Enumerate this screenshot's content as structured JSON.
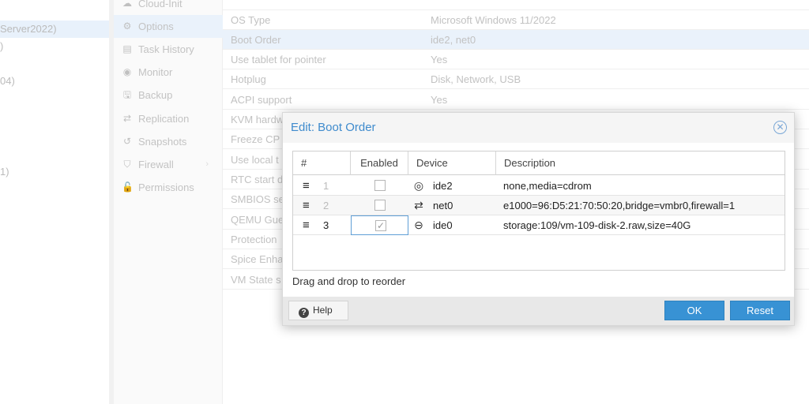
{
  "tree": {
    "items": [
      {
        "label": "Server2022)",
        "selected": true
      },
      {
        "label": ")",
        "selected": false
      },
      {
        "label": "04)",
        "selected": false
      },
      {
        "label": "1)",
        "selected": false
      }
    ]
  },
  "nav": {
    "items": [
      {
        "label": "Cloud-Init",
        "icon": "cloud-icon"
      },
      {
        "label": "Options",
        "icon": "gear-icon",
        "selected": true
      },
      {
        "label": "Task History",
        "icon": "list-icon"
      },
      {
        "label": "Monitor",
        "icon": "eye-icon"
      },
      {
        "label": "Backup",
        "icon": "floppy-icon"
      },
      {
        "label": "Replication",
        "icon": "retweet-icon"
      },
      {
        "label": "Snapshots",
        "icon": "history-icon"
      },
      {
        "label": "Firewall",
        "icon": "shield-icon",
        "has_submenu": true
      },
      {
        "label": "Permissions",
        "icon": "unlock-icon"
      }
    ]
  },
  "options": {
    "rows": [
      {
        "key": "OS Type",
        "value": "Microsoft Windows 11/2022"
      },
      {
        "key": "Boot Order",
        "value": "ide2, net0",
        "selected": true
      },
      {
        "key": "Use tablet for pointer",
        "value": "Yes"
      },
      {
        "key": "Hotplug",
        "value": "Disk, Network, USB"
      },
      {
        "key": "ACPI support",
        "value": "Yes"
      },
      {
        "key": "KVM hardw",
        "value": ""
      },
      {
        "key": "Freeze CP",
        "value": ""
      },
      {
        "key": "Use local t",
        "value": ""
      },
      {
        "key": "RTC start d",
        "value": ""
      },
      {
        "key": "SMBIOS se",
        "value": ""
      },
      {
        "key": "QEMU Gue",
        "value": ""
      },
      {
        "key": "Protection",
        "value": ""
      },
      {
        "key": "Spice Enha",
        "value": ""
      },
      {
        "key": "VM State s",
        "value": ""
      }
    ]
  },
  "dialog": {
    "title": "Edit: Boot Order",
    "close_icon": "close-circle-icon",
    "columns": {
      "num": "#",
      "enabled": "Enabled",
      "device": "Device",
      "description": "Description"
    },
    "rows": [
      {
        "num": "1",
        "enabled": false,
        "device_icon": "cdrom-icon",
        "device": "ide2",
        "description": "none,media=cdrom"
      },
      {
        "num": "2",
        "enabled": false,
        "device_icon": "network-icon",
        "device": "net0",
        "description": "e1000=96:D5:21:70:50:20,bridge=vmbr0,firewall=1"
      },
      {
        "num": "3",
        "enabled": true,
        "device_icon": "hdd-icon",
        "device": "ide0",
        "description": "storage:109/vm-109-disk-2.raw,size=40G"
      }
    ],
    "hint": "Drag and drop to reorder",
    "help_label": "Help",
    "ok_label": "OK",
    "reset_label": "Reset"
  },
  "colors": {
    "accent": "#3892d4",
    "title": "#3f8bcd",
    "selection": "#eaf2fb"
  }
}
